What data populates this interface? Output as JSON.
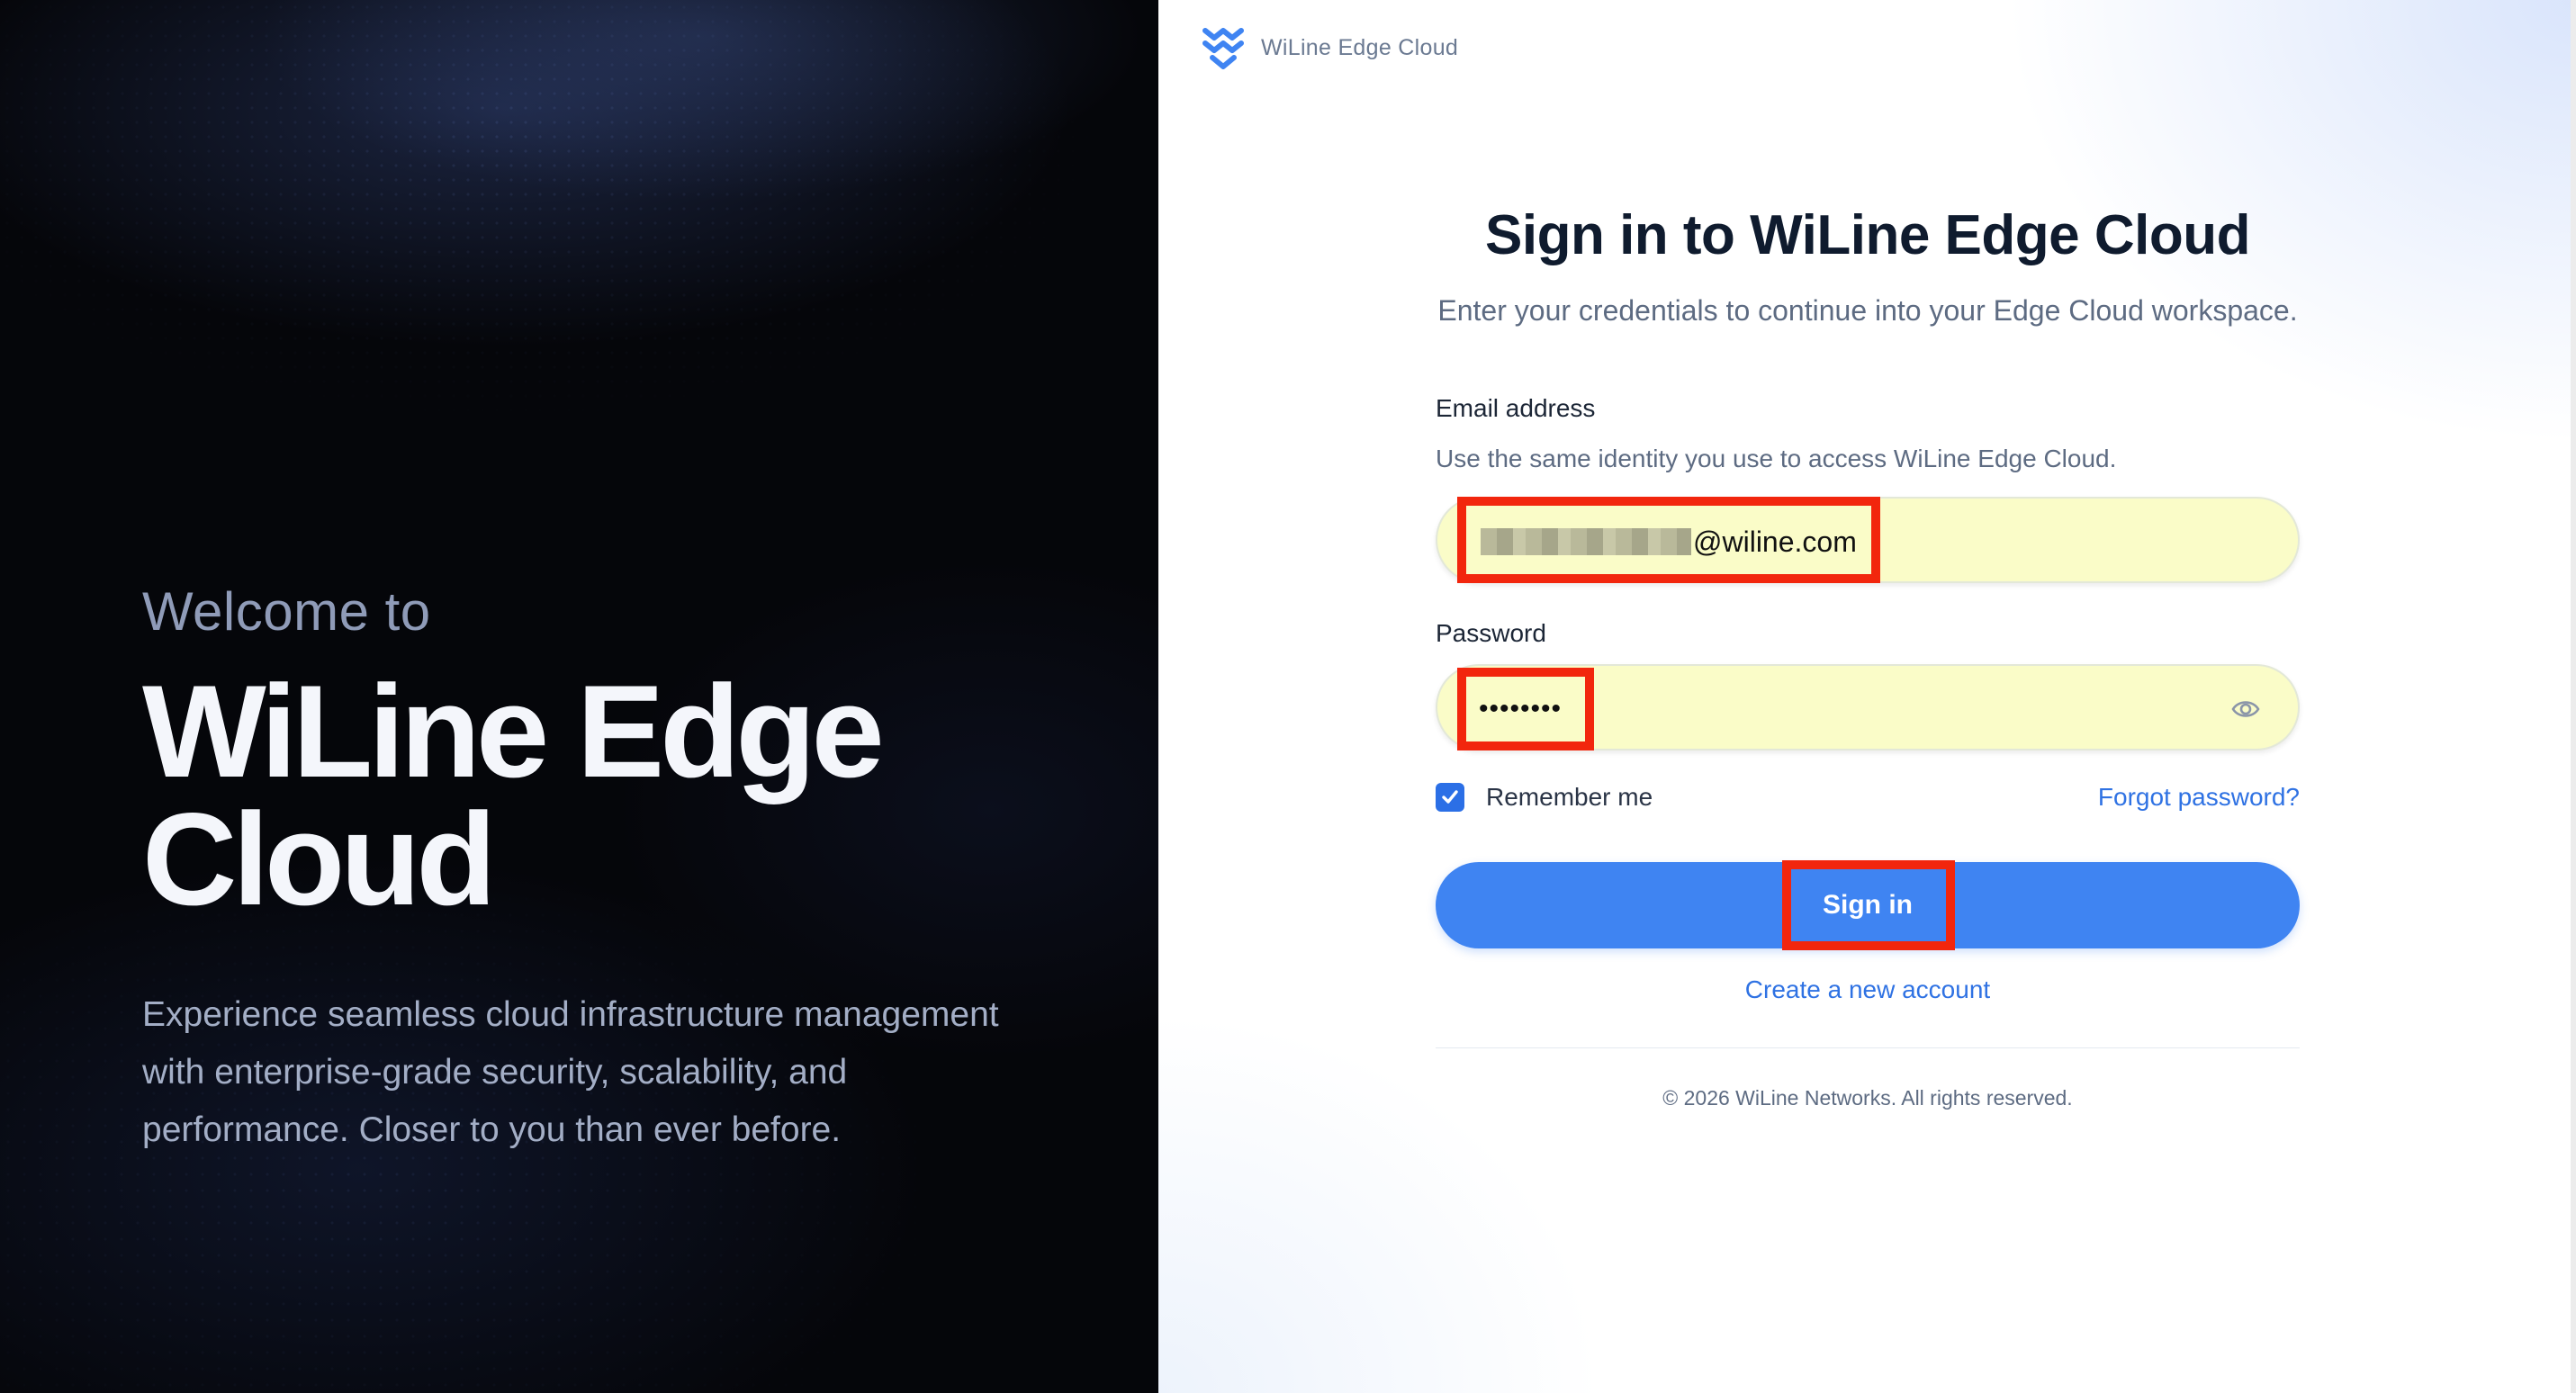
{
  "hero": {
    "welcome": "Welcome to",
    "title": "WiLine Edge Cloud",
    "description": "Experience seamless cloud infrastructure management with enterprise-grade security, scalability, and performance. Closer to you than ever before."
  },
  "brand": {
    "name": "WiLine Edge Cloud",
    "logo_icon": "wiline-logo-icon",
    "logo_color": "#3f84f2"
  },
  "form": {
    "title": "Sign in to WiLine Edge Cloud",
    "subtitle": "Enter your credentials to continue into your Edge Cloud workspace.",
    "email": {
      "label": "Email address",
      "help": "Use the same identity you use to access WiLine Edge Cloud.",
      "value_visible": "@wiline.com"
    },
    "password": {
      "label": "Password",
      "value_masked": "••••••••",
      "toggle_icon": "eye-icon"
    },
    "remember_label": "Remember me",
    "remember_checked": true,
    "forgot_label": "Forgot password?",
    "submit_label": "Sign in",
    "create_account_label": "Create a new account"
  },
  "footer": {
    "copyright": "© 2026 WiLine Networks. All rights reserved."
  },
  "colors": {
    "accent": "#3f84f2",
    "link": "#2f72e3",
    "autofill_bg": "#fafcc8",
    "highlight": "#f2260d",
    "hero_bg": "#05060a"
  }
}
